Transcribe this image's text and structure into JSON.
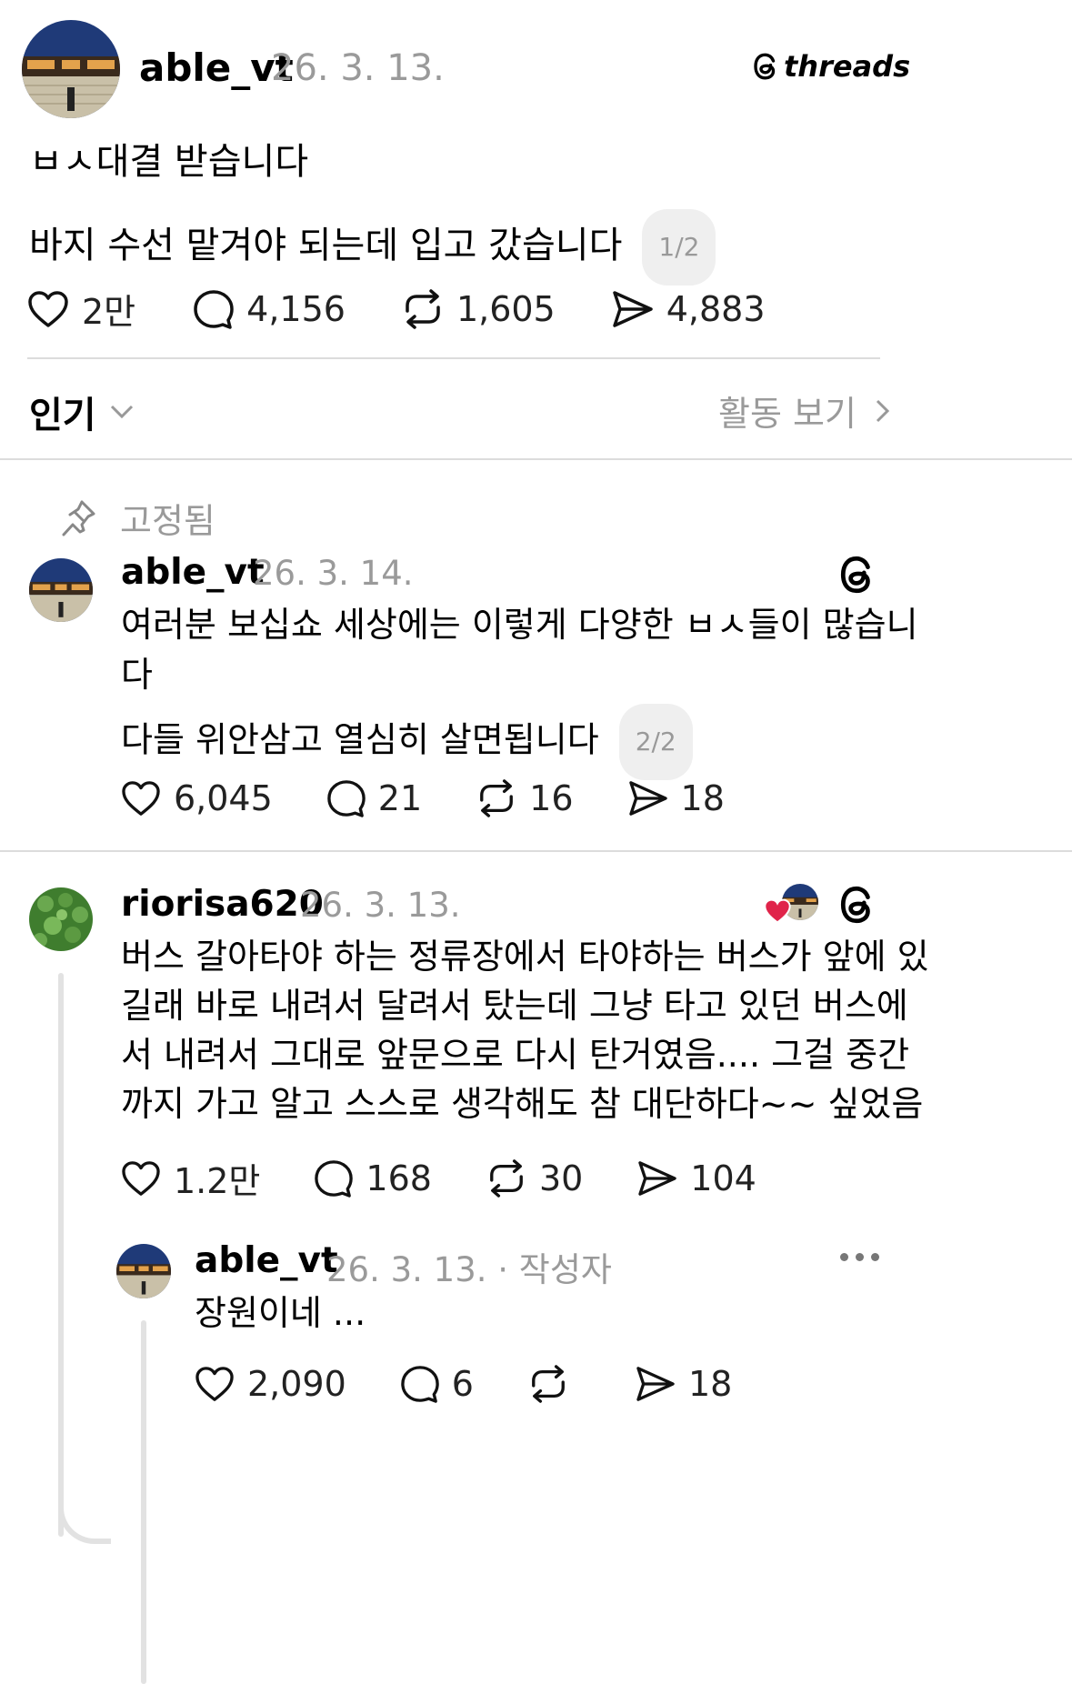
{
  "post": {
    "username": "able_vt",
    "date": "26. 3. 13.",
    "brand": "threads",
    "line1": "ㅂㅅ대결 받습니다",
    "line2": "바지 수선 맡겨야 되는데 입고 갔습니다",
    "page_badge": "1/2",
    "likes": "2만",
    "comments": "4,156",
    "reposts": "1,605",
    "shares": "4,883"
  },
  "sort": {
    "label": "인기",
    "activity": "활동 보기"
  },
  "pinned": {
    "label": "고정됨",
    "username": "able_vt",
    "date": "26. 3. 14.",
    "line1": "여러분 보십쇼 세상에는 이렇게 다양한 ㅂㅅ들이 많습니",
    "line2": "다",
    "line3": "다들 위안삼고 열심히 살면됩니다",
    "page_badge": "2/2",
    "likes": "6,045",
    "comments": "21",
    "reposts": "16",
    "shares": "18"
  },
  "comment": {
    "username": "riorisa620",
    "date": "26. 3. 13.",
    "lines": [
      "버스 갈아타야 하는 정류장에서 타야하는 버스가 앞에 있",
      "길래 바로 내려서 달려서 탔는데 그냥 타고 있던 버스에",
      "서 내려서 그대로 앞문으로 다시 탄거였음.... 그걸 중간",
      "까지 가고 알고 스스로 생각해도 참 대단하다~~ 싶었음"
    ],
    "likes": "1.2만",
    "comments": "168",
    "reposts": "30",
    "shares": "104"
  },
  "reply": {
    "username": "able_vt",
    "date": "26. 3. 13. · 작성자",
    "text": "장원이네 ...",
    "likes": "2,090",
    "comments": "6",
    "reposts": "",
    "shares": "18"
  },
  "colors": {
    "heart": "#e0244a",
    "avatar_sky": "#1f3a78",
    "avatar_clover": "#3f7d2e"
  }
}
